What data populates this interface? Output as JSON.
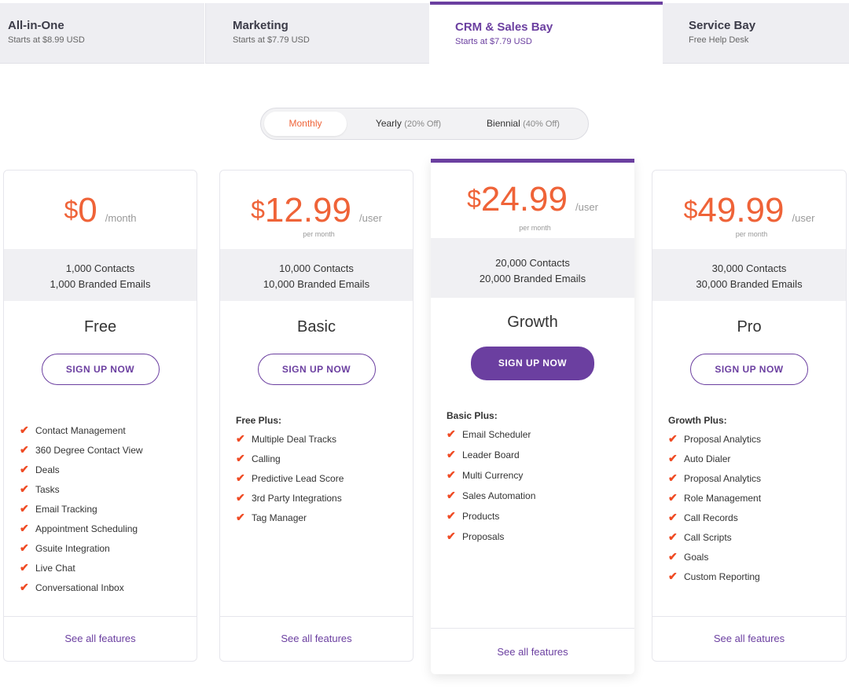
{
  "tabs": [
    {
      "title": "All-in-One",
      "sub": "Starts at $8.99 USD"
    },
    {
      "title": "Marketing",
      "sub": "Starts at $7.79 USD"
    },
    {
      "title": "CRM & Sales Bay",
      "sub": "Starts at $7.79 USD"
    },
    {
      "title": "Service Bay",
      "sub": "Free Help Desk"
    }
  ],
  "billing": {
    "monthly": "Monthly",
    "yearly": "Yearly",
    "yearly_disc": "(20% Off)",
    "biennial": "Biennial",
    "biennial_disc": "(40% Off)"
  },
  "plans": [
    {
      "currency": "$",
      "amount": "0",
      "period": "/month",
      "per_month": "",
      "contacts": "1,000 Contacts",
      "emails": "1,000 Branded Emails",
      "name": "Free",
      "cta": "SIGN UP NOW",
      "features_head": "",
      "features": [
        "Contact Management",
        "360 Degree Contact View",
        "Deals",
        "Tasks",
        "Email Tracking",
        "Appointment Scheduling",
        "Gsuite Integration",
        "Live Chat",
        "Conversational Inbox"
      ],
      "see_all": "See all features"
    },
    {
      "currency": "$",
      "amount": "12.99",
      "period": "/user",
      "per_month": "per month",
      "contacts": "10,000 Contacts",
      "emails": "10,000 Branded Emails",
      "name": "Basic",
      "cta": "SIGN UP NOW",
      "features_head": "Free Plus:",
      "features": [
        "Multiple Deal Tracks",
        "Calling",
        "Predictive Lead Score",
        "3rd Party Integrations",
        "Tag Manager"
      ],
      "see_all": "See all features"
    },
    {
      "currency": "$",
      "amount": "24.99",
      "period": "/user",
      "per_month": "per month",
      "contacts": "20,000 Contacts",
      "emails": "20,000 Branded Emails",
      "name": "Growth",
      "cta": "SIGN UP NOW",
      "features_head": "Basic Plus:",
      "features": [
        "Email Scheduler",
        "Leader Board",
        "Multi Currency",
        "Sales Automation",
        "Products",
        "Proposals"
      ],
      "see_all": "See all features"
    },
    {
      "currency": "$",
      "amount": "49.99",
      "period": "/user",
      "per_month": "per month",
      "contacts": "30,000 Contacts",
      "emails": "30,000 Branded Emails",
      "name": "Pro",
      "cta": "SIGN UP NOW",
      "features_head": "Growth Plus:",
      "features": [
        "Proposal Analytics",
        "Auto Dialer",
        "Proposal Analytics",
        "Role Management",
        "Call Records",
        "Call Scripts",
        "Goals",
        "Custom Reporting"
      ],
      "see_all": "See all features"
    }
  ],
  "icons": {
    "feature_check": "check-icon"
  },
  "colors": {
    "accent_purple": "#6b3fa0",
    "price_orange": "#ef6338",
    "check_red": "#ef4a23"
  }
}
